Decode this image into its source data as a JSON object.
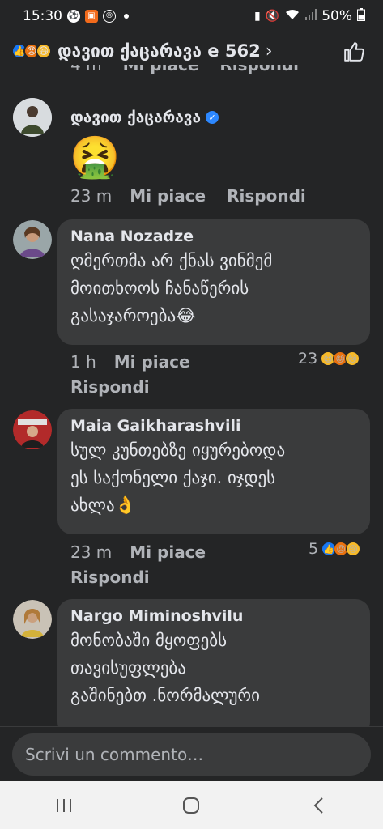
{
  "status_bar": {
    "time": "15:30",
    "battery": "50%"
  },
  "header": {
    "title": "დავით ქაცარავა e 562",
    "chevron": "›"
  },
  "cropped_meta": {
    "time": "4 m",
    "like": "Mi piace",
    "reply": "Rispondi"
  },
  "comments": [
    {
      "name": "დავით ქაცარავა",
      "verified": true,
      "emoji": "🤮",
      "time": "23 m",
      "like": "Mi piace",
      "reply": "Rispondi"
    },
    {
      "name": "Nana Nozadze",
      "lines": [
        "ღმერთმა არ ქნას ვინმემ",
        "მოითხოოს ჩანაწერის",
        "გასაჯაროება😂"
      ],
      "time": "1 h",
      "like": "Mi piace",
      "reply": "Rispondi",
      "reaction_count": "23"
    },
    {
      "name": "Maia Gaikharashvili",
      "lines": [
        "სულ კუნთებზე იყურებოდა",
        "ეს საქონელი ქაჯი. იჯდეს",
        "ახლა👌"
      ],
      "time": "23 m",
      "like": "Mi piace",
      "reply": "Rispondi",
      "reaction_count": "5"
    },
    {
      "name": "Nargo Miminoshvilu",
      "lines": [
        "მონობაში მყოფებს",
        "თავისუფლება",
        "გაშინებთ .ნორმალური"
      ]
    }
  ],
  "input": {
    "placeholder": "Scrivi un commento…"
  },
  "colors": {
    "background": "#242526",
    "bubble": "#3a3b3c",
    "text": "#e4e6eb",
    "secondary": "#b0b3b8",
    "verified": "#2d88ff",
    "nav_bar": "#f2f2f2"
  }
}
